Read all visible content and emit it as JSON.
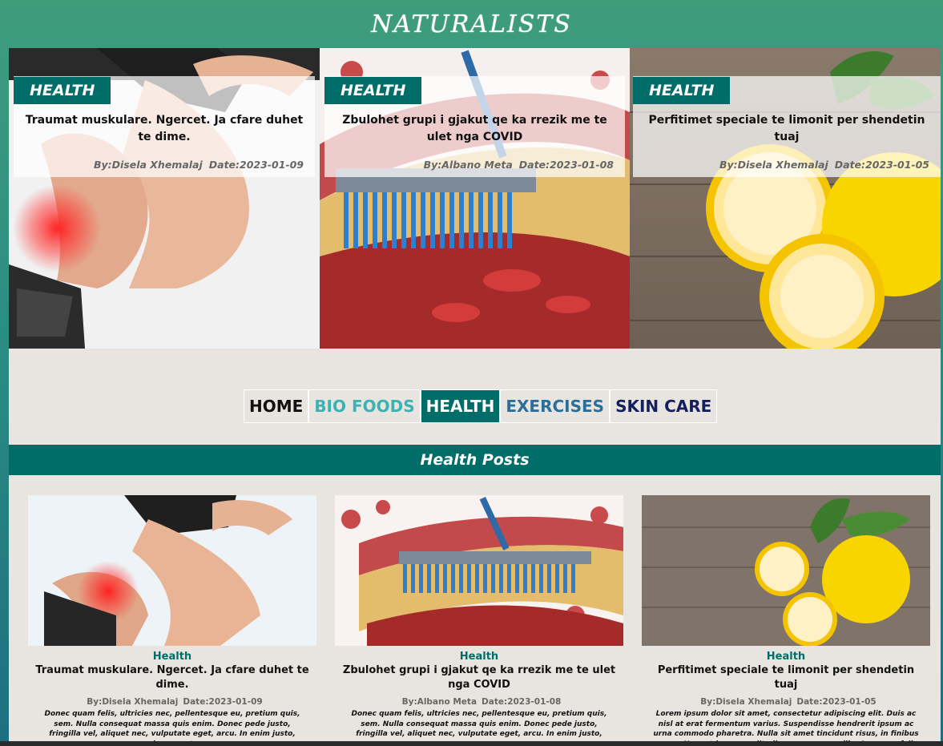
{
  "site": {
    "brand": "NATURALISTS"
  },
  "hero": [
    {
      "tag": "HEALTH",
      "title": "Traumat muskulare. Ngercet. Ja cfare duhet te dime.",
      "author": "By:Disela Xhemalaj",
      "date": "Date:2023-01-09",
      "image": "knee-pain-photo"
    },
    {
      "tag": "HEALTH",
      "title": "Zbulohet grupi i gjakut qe ka rrezik me te ulet nga COVID",
      "author": "By:Albano Meta",
      "date": "Date:2023-01-08",
      "image": "artery-brush-illustration"
    },
    {
      "tag": "HEALTH",
      "title": "Perfitimet speciale te limonit per shendetin tuaj",
      "author": "By:Disela Xhemalaj",
      "date": "Date:2023-01-05",
      "image": "lemons-photo"
    }
  ],
  "nav": [
    {
      "label": "HOME",
      "color": "#111111",
      "active": false
    },
    {
      "label": "BIO FOODS",
      "color": "#3bb3b3",
      "active": false
    },
    {
      "label": "HEALTH",
      "color": "#ffffff",
      "active": true
    },
    {
      "label": "EXERCISES",
      "color": "#2a6f9a",
      "active": false
    },
    {
      "label": "SKIN CARE",
      "color": "#14205e",
      "active": false
    }
  ],
  "section": {
    "title": "Health Posts"
  },
  "posts": [
    {
      "category": "Health",
      "title": "Traumat muskulare. Ngercet. Ja cfare duhet te dime.",
      "author": "By:Disela Xhemalaj",
      "date": "Date:2023-01-09",
      "excerpt": "Donec quam felis, ultricies nec, pellentesque eu, pretium quis, sem. Nulla consequat massa quis enim. Donec pede justo, fringilla vel, aliquet nec, vulputate eget, arcu. In enim justo, rhoncus ut,"
    },
    {
      "category": "Health",
      "title": "Zbulohet grupi i gjakut qe ka rrezik me te ulet nga COVID",
      "author": "By:Albano Meta",
      "date": "Date:2023-01-08",
      "excerpt": "Donec quam felis, ultricies nec, pellentesque eu, pretium quis, sem. Nulla consequat massa quis enim. Donec pede justo, fringilla vel, aliquet nec, vulputate eget, arcu. In enim justo,"
    },
    {
      "category": "Health",
      "title": "Perfitimet speciale te limonit per shendetin tuaj",
      "author": "By:Disela Xhemalaj",
      "date": "Date:2023-01-05",
      "excerpt": "Lorem ipsum dolor sit amet, consectetur adipiscing elit. Duis ac nisl at erat fermentum varius. Suspendisse hendrerit ipsum ac urna commodo pharetra. Nulla sit amet tincidunt risus, in finibus purus. Nam ut lacus eu elit ullamcorper convallis. Aenean a felis sodales, hendrerit neque tincidunt, ornare lectus. Donec"
    }
  ],
  "colors": {
    "accent": "#006d69",
    "page_bg": "#e8e5e0"
  }
}
